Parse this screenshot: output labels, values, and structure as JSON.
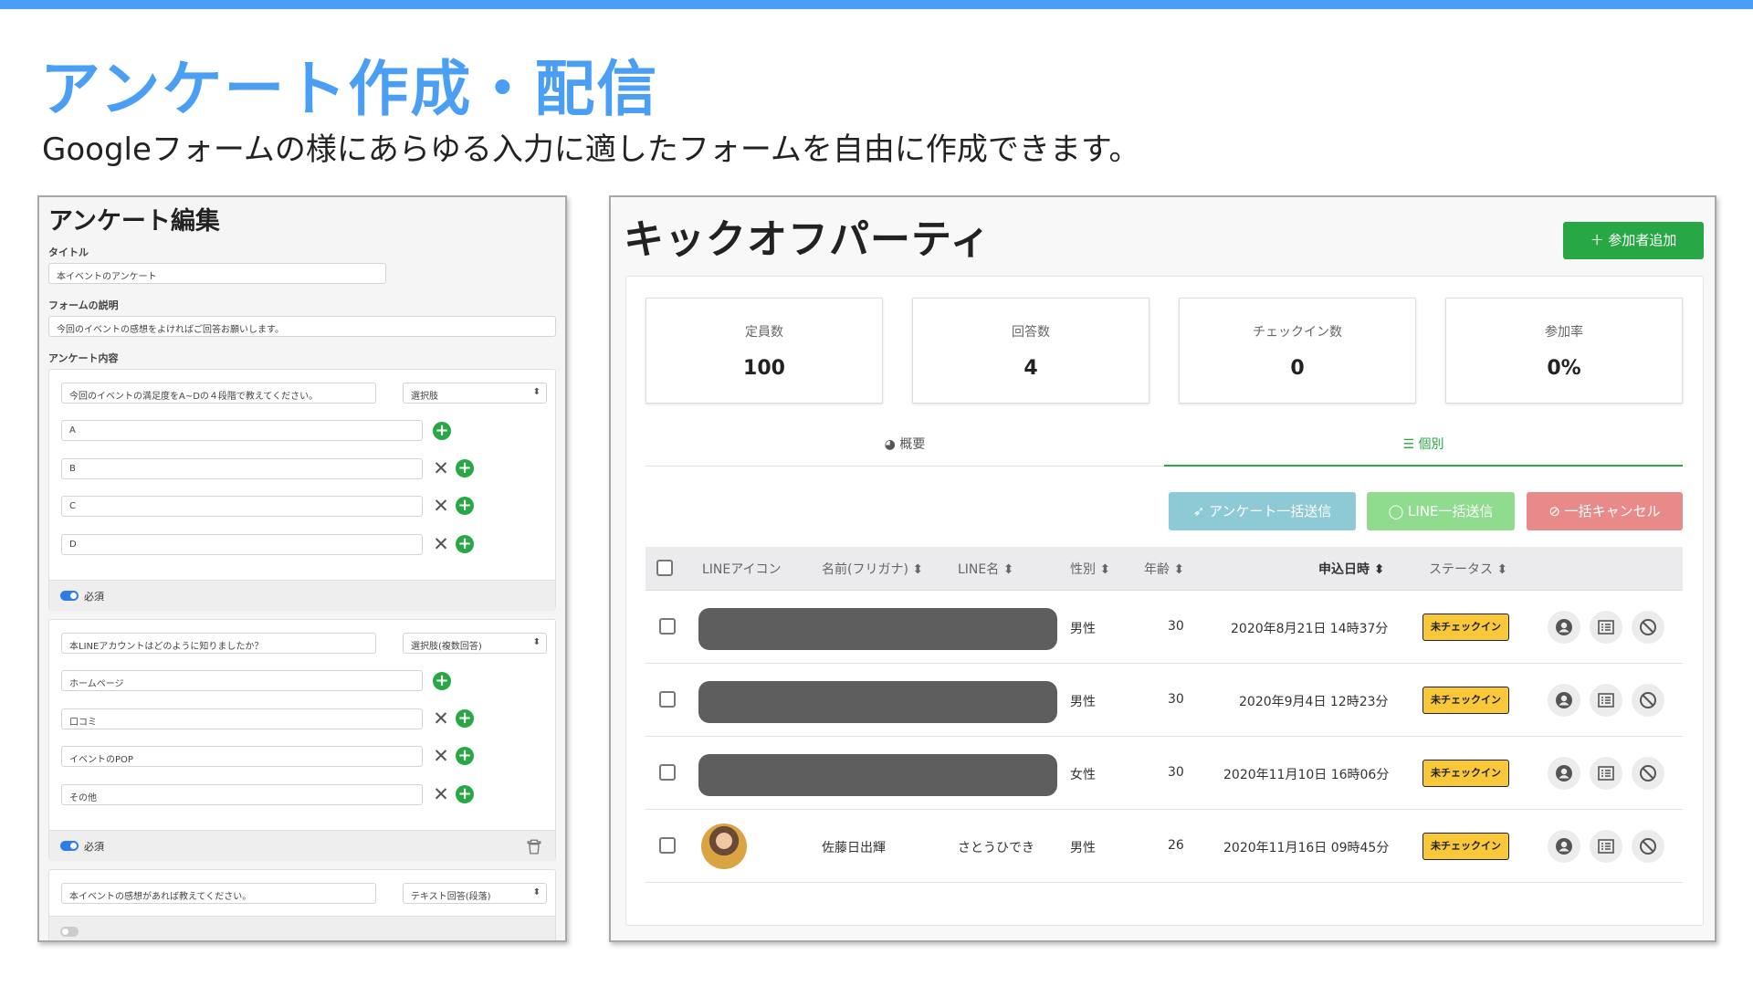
{
  "slide": {
    "title": "アンケート作成・配信",
    "subtitle": "Googleフォームの様にあらゆる入力に適したフォームを自由に作成できます。"
  },
  "editor": {
    "title": "アンケート編集",
    "title_label": "タイトル",
    "title_value": "本イベントのアンケート",
    "desc_label": "フォームの説明",
    "desc_value": "今回のイベントの感想をよければご回答お願いします。",
    "content_label": "アンケート内容",
    "required_label": "必須",
    "questions": [
      {
        "text": "今回のイベントの満足度をA~Dの４段階で教えてください。",
        "type": "選択肢",
        "options": [
          "A",
          "B",
          "C",
          "D"
        ]
      },
      {
        "text": "本LINEアカウントはどのように知りましたか？",
        "type": "選択肢(複数回答)",
        "options": [
          "ホームページ",
          "口コミ",
          "イベントのPOP",
          "その他"
        ]
      },
      {
        "text": "本イベントの感想があれば教えてください。",
        "type": "テキスト回答(段落)"
      }
    ]
  },
  "event": {
    "title": "キックオフパーティ",
    "add_button": "参加者追加",
    "stats": [
      {
        "label": "定員数",
        "value": "100"
      },
      {
        "label": "回答数",
        "value": "4"
      },
      {
        "label": "チェックイン数",
        "value": "0"
      },
      {
        "label": "参加率",
        "value": "0%"
      }
    ],
    "tabs": {
      "overview": "概要",
      "individual": "個別"
    },
    "bulk": {
      "survey": "アンケート一括送信",
      "line": "LINE一括送信",
      "cancel": "一括キャンセル"
    },
    "columns": {
      "icon": "LINEアイコン",
      "name": "名前(フリガナ)",
      "line_name": "LINE名",
      "gender": "性別",
      "age": "年齢",
      "applied": "申込日時",
      "status": "ステータス"
    },
    "rows": [
      {
        "name": "",
        "line_name": "",
        "gender": "男性",
        "age": "30",
        "applied": "2020年8月21日 14時37分",
        "status": "未チェックイン"
      },
      {
        "name": "",
        "line_name": "",
        "gender": "男性",
        "age": "30",
        "applied": "2020年9月4日 12時23分",
        "status": "未チェックイン"
      },
      {
        "name": "",
        "line_name": "",
        "gender": "女性",
        "age": "30",
        "applied": "2020年11月10日 16時06分",
        "status": "未チェックイン"
      },
      {
        "name": "佐藤日出輝",
        "line_name": "さとうひでき",
        "gender": "男性",
        "age": "26",
        "applied": "2020年11月16日 09時45分",
        "status": "未チェックイン"
      }
    ]
  },
  "colors": {
    "accent": "#4a9ff5",
    "green": "#28a745",
    "survey_btn": "#8ecad6",
    "line_btn": "#8fdc8f",
    "cancel_btn": "#e98a8a",
    "badge": "#f8c73a"
  },
  "icons": {
    "add": "plus-icon",
    "overview": "pie-chart-icon",
    "individual": "list-icon",
    "survey": "paper-plane-icon",
    "line": "speech-bubble-icon",
    "cancel": "ban-icon",
    "row_actions": [
      "user-circle-icon",
      "list-icon",
      "ban-icon"
    ]
  }
}
